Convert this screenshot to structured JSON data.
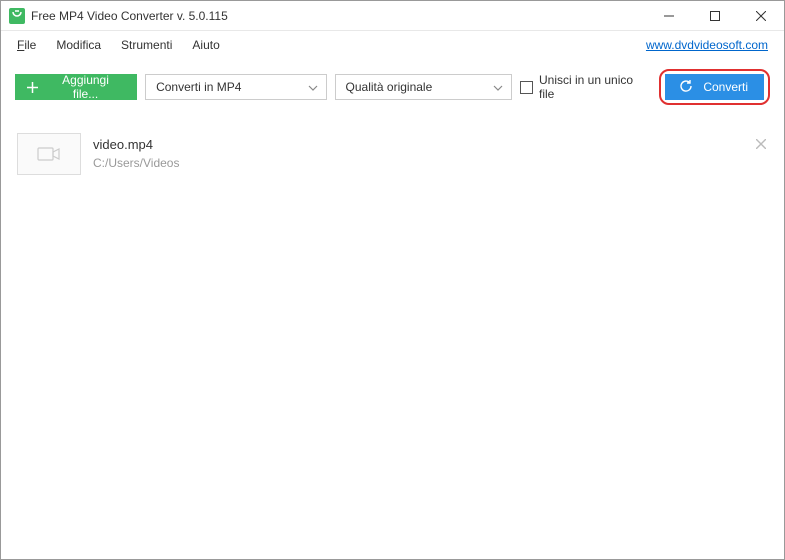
{
  "titlebar": {
    "title": "Free MP4 Video Converter v. 5.0.115"
  },
  "menubar": {
    "file": "File",
    "edit": "Modifica",
    "tools": "Strumenti",
    "help": "Aiuto",
    "link": "www.dvdvideosoft.com"
  },
  "toolbar": {
    "add_label": "Aggiungi file...",
    "format_selected": "Converti in MP4",
    "quality_selected": "Qualità originale",
    "merge_label": "Unisci in un unico file",
    "convert_label": "Converti"
  },
  "files": [
    {
      "name": "video.mp4",
      "path": "C:/Users/Videos"
    }
  ]
}
